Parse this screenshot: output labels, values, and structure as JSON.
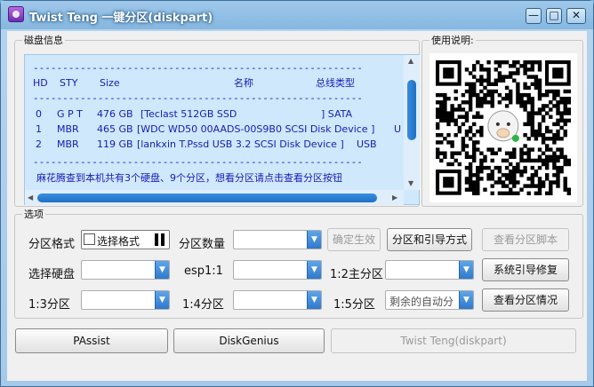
{
  "window": {
    "title": "Twist Teng 一键分区(diskpart)",
    "controls": {
      "minimize": "—",
      "maximize": "□",
      "close": "✕"
    }
  },
  "disk_info": {
    "legend": "磁盘信息",
    "separator": "--------------------------------------------------------",
    "headers": {
      "hd": "HD",
      "sty": "STY",
      "size": "Size",
      "name": "名称",
      "bus": "总线类型"
    },
    "rows": [
      {
        "hd": "0",
        "sty": "G P T",
        "size": "476 GB",
        "name": "[Teclast 512GB SSD",
        "bus": "] SATA"
      },
      {
        "hd": "1",
        "sty": "MBR",
        "size": "465 GB",
        "name": "[WDC WD50 00AADS-00S9B0 SCSI Disk Device ]",
        "bus": "U"
      },
      {
        "hd": "2",
        "sty": "MBR",
        "size": "119 GB",
        "name": "[lankxin T.Pssd USB 3.2 SCSI Disk Device ]",
        "bus": "USB"
      }
    ],
    "summary": "麻花腾查到本机共有3个硬盘、9个分区，想看分区请点击查看分区按钮"
  },
  "usage": {
    "legend": "使用说明:"
  },
  "options": {
    "legend": "选项",
    "partition_format_label": "分区格式",
    "select_format_label": "选择格式",
    "partition_count_label": "分区数量",
    "partition_count_value": "",
    "confirm_button": "确定生效",
    "boot_method_button": "分区和引导方式",
    "view_script_button": "查看分区脚本",
    "select_disk_label": "选择硬盘",
    "select_disk_value": "",
    "esp_label": "esp1:1",
    "esp_value": "",
    "main_partition_label": "1:2主分区",
    "main_partition_value": "",
    "repair_boot_button": "系统引导修复",
    "p3_label": "1:3分区",
    "p3_value": "",
    "p4_label": "1:4分区",
    "p4_value": "",
    "p5_label": "1:5分区",
    "p5_value": "剩余的自动分",
    "view_partitions_button": "查看分区情况"
  },
  "bottom": {
    "passist_button": "PAssist",
    "diskgenius_button": "DiskGenius",
    "twist_button": "Twist Teng(diskpart)"
  },
  "colors": {
    "disk_text": "#1a1ab8",
    "panel_bg": "#cfe8fb",
    "accent": "#2f79cc"
  }
}
